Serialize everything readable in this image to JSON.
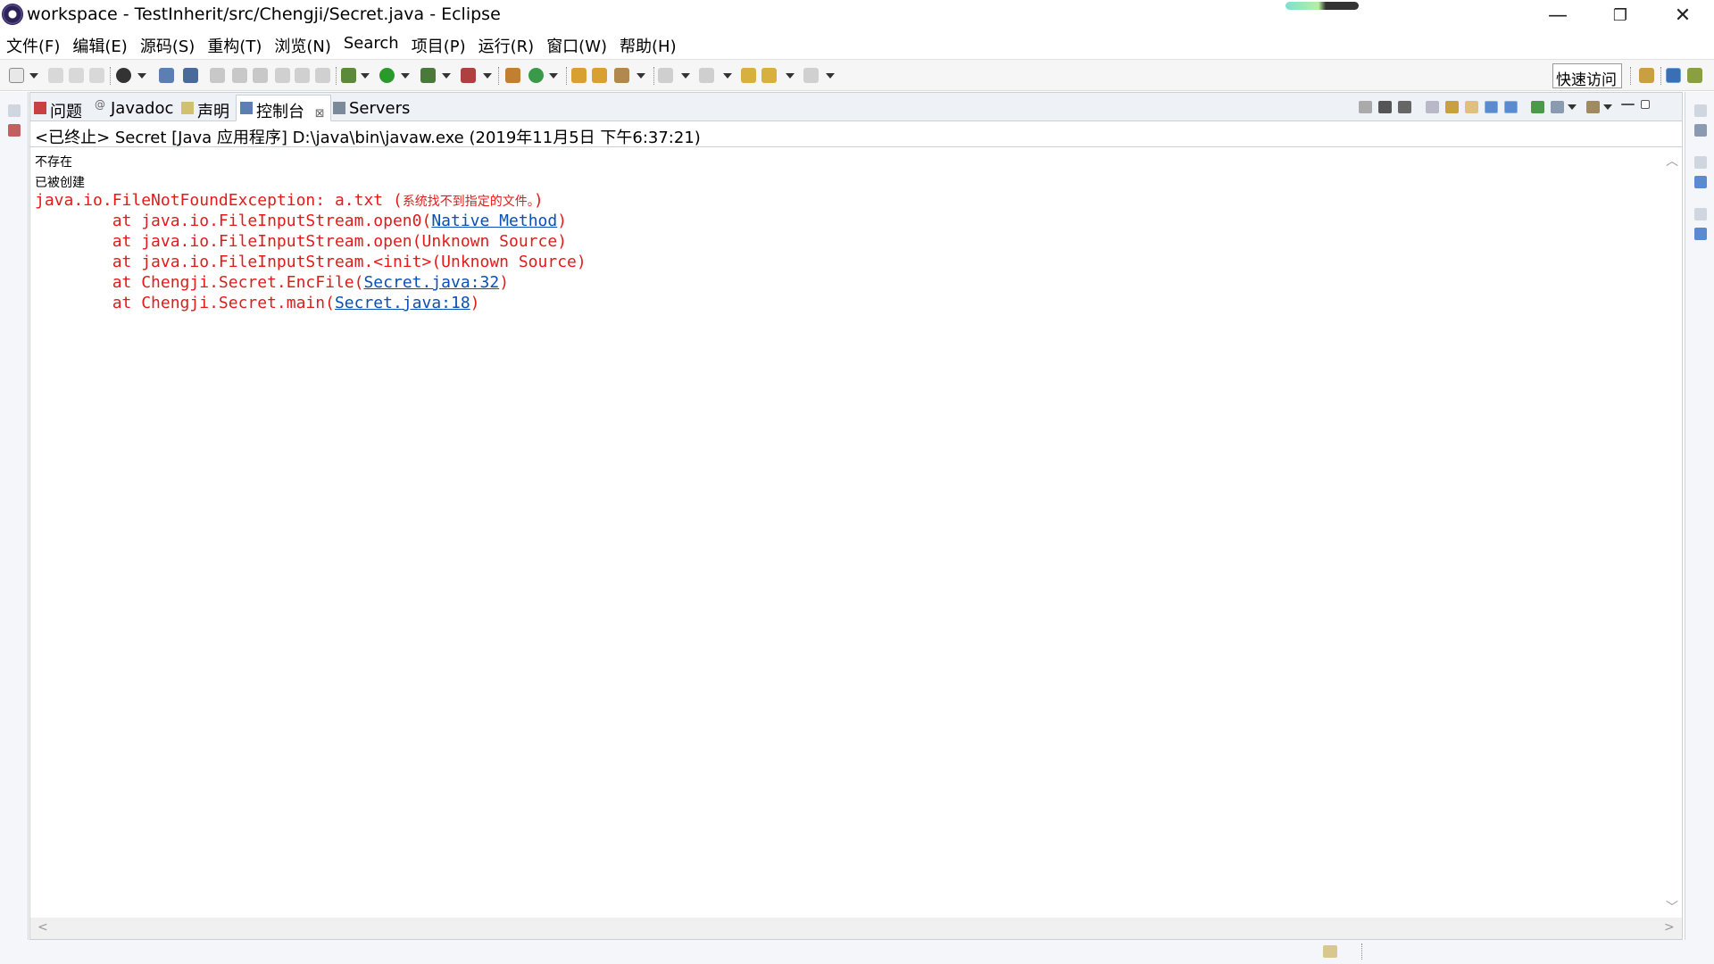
{
  "window": {
    "title": "workspace - TestInherit/src/Chengji/Secret.java - Eclipse",
    "minimize": "—",
    "restore": "❐",
    "close": "✕"
  },
  "menu": [
    "文件(F)",
    "编辑(E)",
    "源码(S)",
    "重构(T)",
    "浏览(N)",
    "Search",
    "项目(P)",
    "运行(R)",
    "窗口(W)",
    "帮助(H)"
  ],
  "toolbar": {
    "quick_access": "快速访问"
  },
  "tabs": [
    {
      "label": "问题",
      "icon": "problems-icon"
    },
    {
      "label": "Javadoc",
      "icon": "javadoc-icon"
    },
    {
      "label": "声明",
      "icon": "declaration-icon"
    },
    {
      "label": "控制台",
      "icon": "console-icon",
      "active": true,
      "close": "⊠"
    },
    {
      "label": "Servers",
      "icon": "servers-icon"
    }
  ],
  "console": {
    "header": "<已终止> Secret [Java 应用程序] D:\\java\\bin\\javaw.exe  (2019年11月5日 下午6:37:21)",
    "plain_lines": [
      "不存在",
      "已被创建"
    ],
    "exception_main": "java.io.FileNotFoundException: a.txt (",
    "exception_msg": "系统找不到指定的文件。",
    "exception_close": ")",
    "stack": [
      {
        "prefix": "        at java.io.FileInputStream.open0(",
        "link": "Native Method",
        "suffix": ")"
      },
      {
        "prefix": "        at java.io.FileInputStream.open(Unknown Source)",
        "link": "",
        "suffix": ""
      },
      {
        "prefix": "        at java.io.FileInputStream.<init>(Unknown Source)",
        "link": "",
        "suffix": ""
      },
      {
        "prefix": "        at Chengji.Secret.EncFile(",
        "link": "Secret.java:32",
        "suffix": ")"
      },
      {
        "prefix": "        at Chengji.Secret.main(",
        "link": "Secret.java:18",
        "suffix": ")"
      }
    ]
  },
  "colors": {
    "error_text": "#e21a1a",
    "link": "#0a4fb5"
  }
}
